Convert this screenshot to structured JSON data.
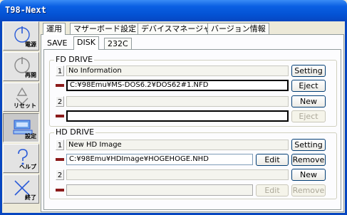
{
  "window": {
    "title": "T98-Next"
  },
  "sidebar": {
    "items": [
      {
        "label": "電源",
        "icon": "power-icon"
      },
      {
        "label": "再開",
        "icon": "power-resume-icon"
      },
      {
        "label": "リセット",
        "icon": "recycle-icon"
      },
      {
        "label": "設定",
        "icon": "computer-settings-icon"
      },
      {
        "label": "ヘルプ",
        "icon": "help-icon"
      },
      {
        "label": "終了",
        "icon": "close-x-icon"
      }
    ]
  },
  "tabs": {
    "main": [
      "運用",
      "マザーボード設定",
      "デバイスマネージャ",
      "バージョン情報"
    ],
    "sub": [
      "SAVE",
      "DISK",
      "232C"
    ]
  },
  "fd": {
    "title": "FD DRIVE",
    "drive1": {
      "num": "1",
      "info": "No Information",
      "path": "C:¥98Emu¥MS-DOS6.2¥DOS62#1.NFD",
      "setting": "Setting",
      "eject": "Eject"
    },
    "drive2": {
      "num": "2",
      "info": "",
      "path": "",
      "new": "New",
      "eject": "Eject"
    }
  },
  "hd": {
    "title": "HD DRIVE",
    "drive1": {
      "num": "1",
      "info": "New HD Image",
      "path": "C:¥98Emu¥HDImage¥HOGEHOGE.NHD",
      "setting": "Setting",
      "edit": "Edit",
      "remove": "Remove"
    },
    "drive2": {
      "num": "2",
      "info": "",
      "path": "",
      "new": "New",
      "edit": "Edit",
      "remove": "Remove"
    }
  },
  "colors": {
    "titlebar": "#0452d3",
    "indicator": "#8b1a1a"
  }
}
